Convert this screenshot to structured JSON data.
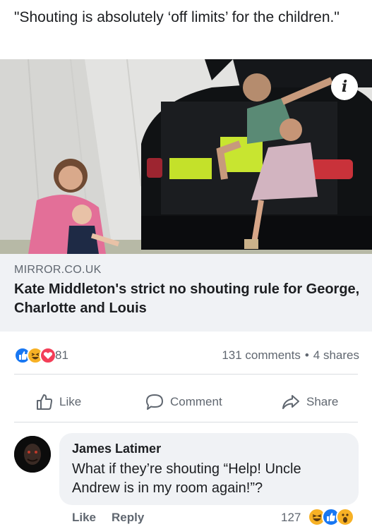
{
  "post": {
    "text": "\"Shouting is absolutely ‘off limits’ for the children.\""
  },
  "link_preview": {
    "domain": "MIRROR.CO.UK",
    "title": "Kate Middleton's strict no shouting rule for George, Charlotte and Louis",
    "image_icon": "info-icon",
    "info_badge": "i"
  },
  "stats": {
    "reaction_icons": [
      "like-icon",
      "haha-icon",
      "love-icon"
    ],
    "reaction_count": "81",
    "comments": "131 comments",
    "separator": "•",
    "shares": "4 shares"
  },
  "actions": {
    "like": "Like",
    "comment": "Comment",
    "share": "Share"
  },
  "comment": {
    "author": "James Latimer",
    "text": "What if they’re shouting “Help! Uncle Andrew is in my room again!”?",
    "like": "Like",
    "reply": "Reply",
    "reaction_count": "127",
    "reaction_icons": [
      "haha-icon",
      "like-icon",
      "wow-icon"
    ]
  },
  "colors": {
    "facebook_blue": "#1877f2",
    "love_red": "#f33e58",
    "haha_yellow": "#f7b125",
    "secondary_text": "#606770",
    "card_background": "#f0f2f5"
  }
}
